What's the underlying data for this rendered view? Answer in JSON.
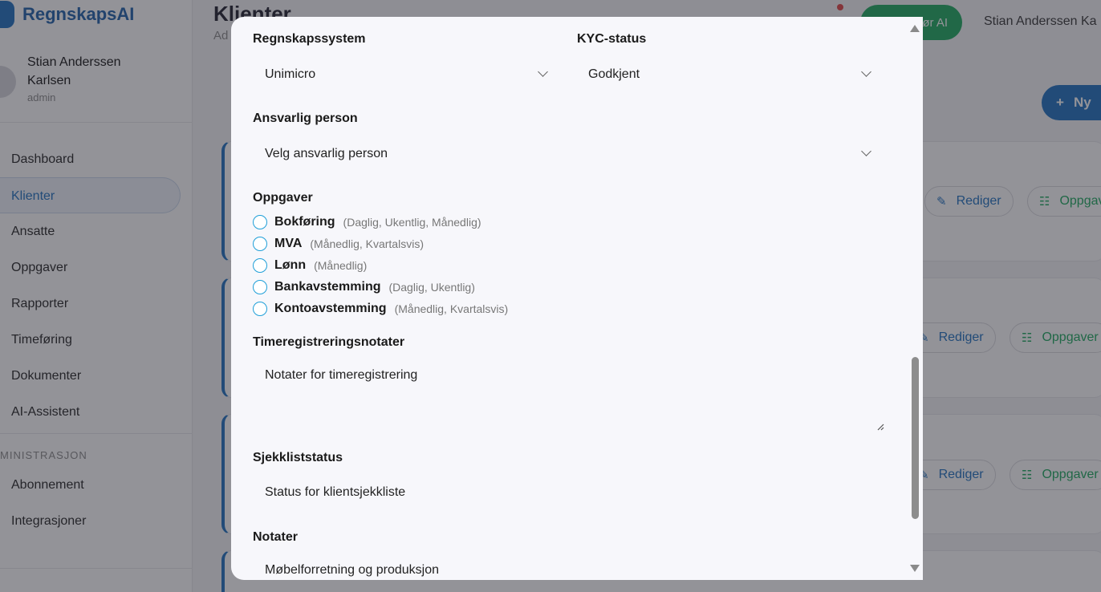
{
  "app": {
    "brand": "RegnskapsAI",
    "user_name": "Stian Anderssen Karlsen",
    "user_role": "admin",
    "nav": [
      "Dashboard",
      "Klienter",
      "Ansatte",
      "Oppgaver",
      "Rapporter",
      "Timeføring",
      "Dokumenter",
      "AI-Assistent"
    ],
    "nav_section": "MINISTRASJON",
    "nav2": [
      "Abonnement",
      "Integrasjoner"
    ],
    "page_title": "Klienter",
    "page_sub": "Ad",
    "ask_ai": "Spør AI",
    "top_user": "Stian Anderssen Ka",
    "new_button": "Ny",
    "edit_label": "Rediger",
    "tasks_label": "Oppgaver"
  },
  "modal": {
    "accounting_system": {
      "label": "Regnskapssystem",
      "value": "Unimicro"
    },
    "kyc": {
      "label": "KYC-status",
      "value": "Godkjent"
    },
    "responsible": {
      "label": "Ansvarlig person",
      "value": "Velg ansvarlig person"
    },
    "tasks_label": "Oppgaver",
    "tasks": [
      {
        "name": "Bokføring",
        "freq": "(Daglig, Ukentlig, Månedlig)"
      },
      {
        "name": "MVA",
        "freq": "(Månedlig, Kvartalsvis)"
      },
      {
        "name": "Lønn",
        "freq": "(Månedlig)"
      },
      {
        "name": "Bankavstemming",
        "freq": "(Daglig, Ukentlig)"
      },
      {
        "name": "Kontoavstemming",
        "freq": "(Månedlig, Kvartalsvis)"
      }
    ],
    "time_notes": {
      "label": "Timeregistreringsnotater",
      "placeholder": "Notater for timeregistrering"
    },
    "checklist": {
      "label": "Sjekkliststatus",
      "placeholder": "Status for klientsjekkliste"
    },
    "notes": {
      "label": "Notater",
      "value": "Møbelforretning og produksjon"
    }
  }
}
